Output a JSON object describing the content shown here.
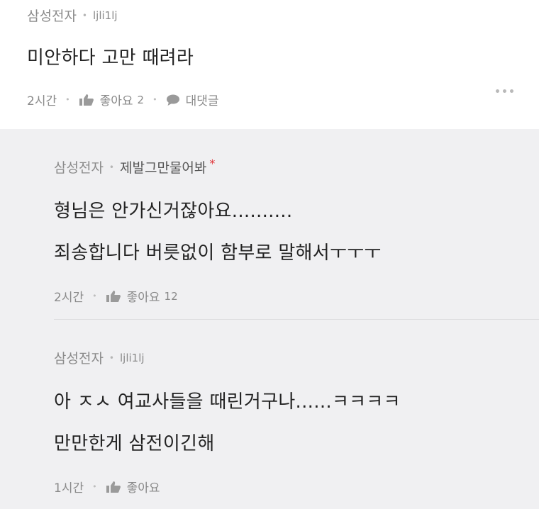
{
  "comment": {
    "author": "삼성전자",
    "nickname": "ljli1lj",
    "text": "미안하다 고만 때려라",
    "time": "2시간",
    "like_label": "좋아요",
    "like_count": "2",
    "reply_label": "대댓글"
  },
  "replies": [
    {
      "author": "삼성전자",
      "nickname": "제발그만물어봐",
      "marker": "*",
      "lines": [
        "형님은 안가신거잖아요..........",
        "죄송합니다 버릇없이 함부로 말해서ㅜㅜㅜ"
      ],
      "time": "2시간",
      "like_label": "좋아요",
      "like_count": "12"
    },
    {
      "author": "삼성전자",
      "nickname": "ljli1lj",
      "lines": [
        "아 ㅈㅅ 여교사들을 때린거구나......ㅋㅋㅋㅋ",
        "만만한게 삼전이긴해"
      ],
      "time": "1시간",
      "like_label": "좋아요"
    }
  ],
  "colors": {
    "background": "#f0f0f2",
    "surface": "#ffffff",
    "muted": "#8a8a8a",
    "marker": "#e0353a"
  },
  "icons": [
    "thumbs-up-icon",
    "speech-bubble-icon",
    "more-dots-icon"
  ]
}
